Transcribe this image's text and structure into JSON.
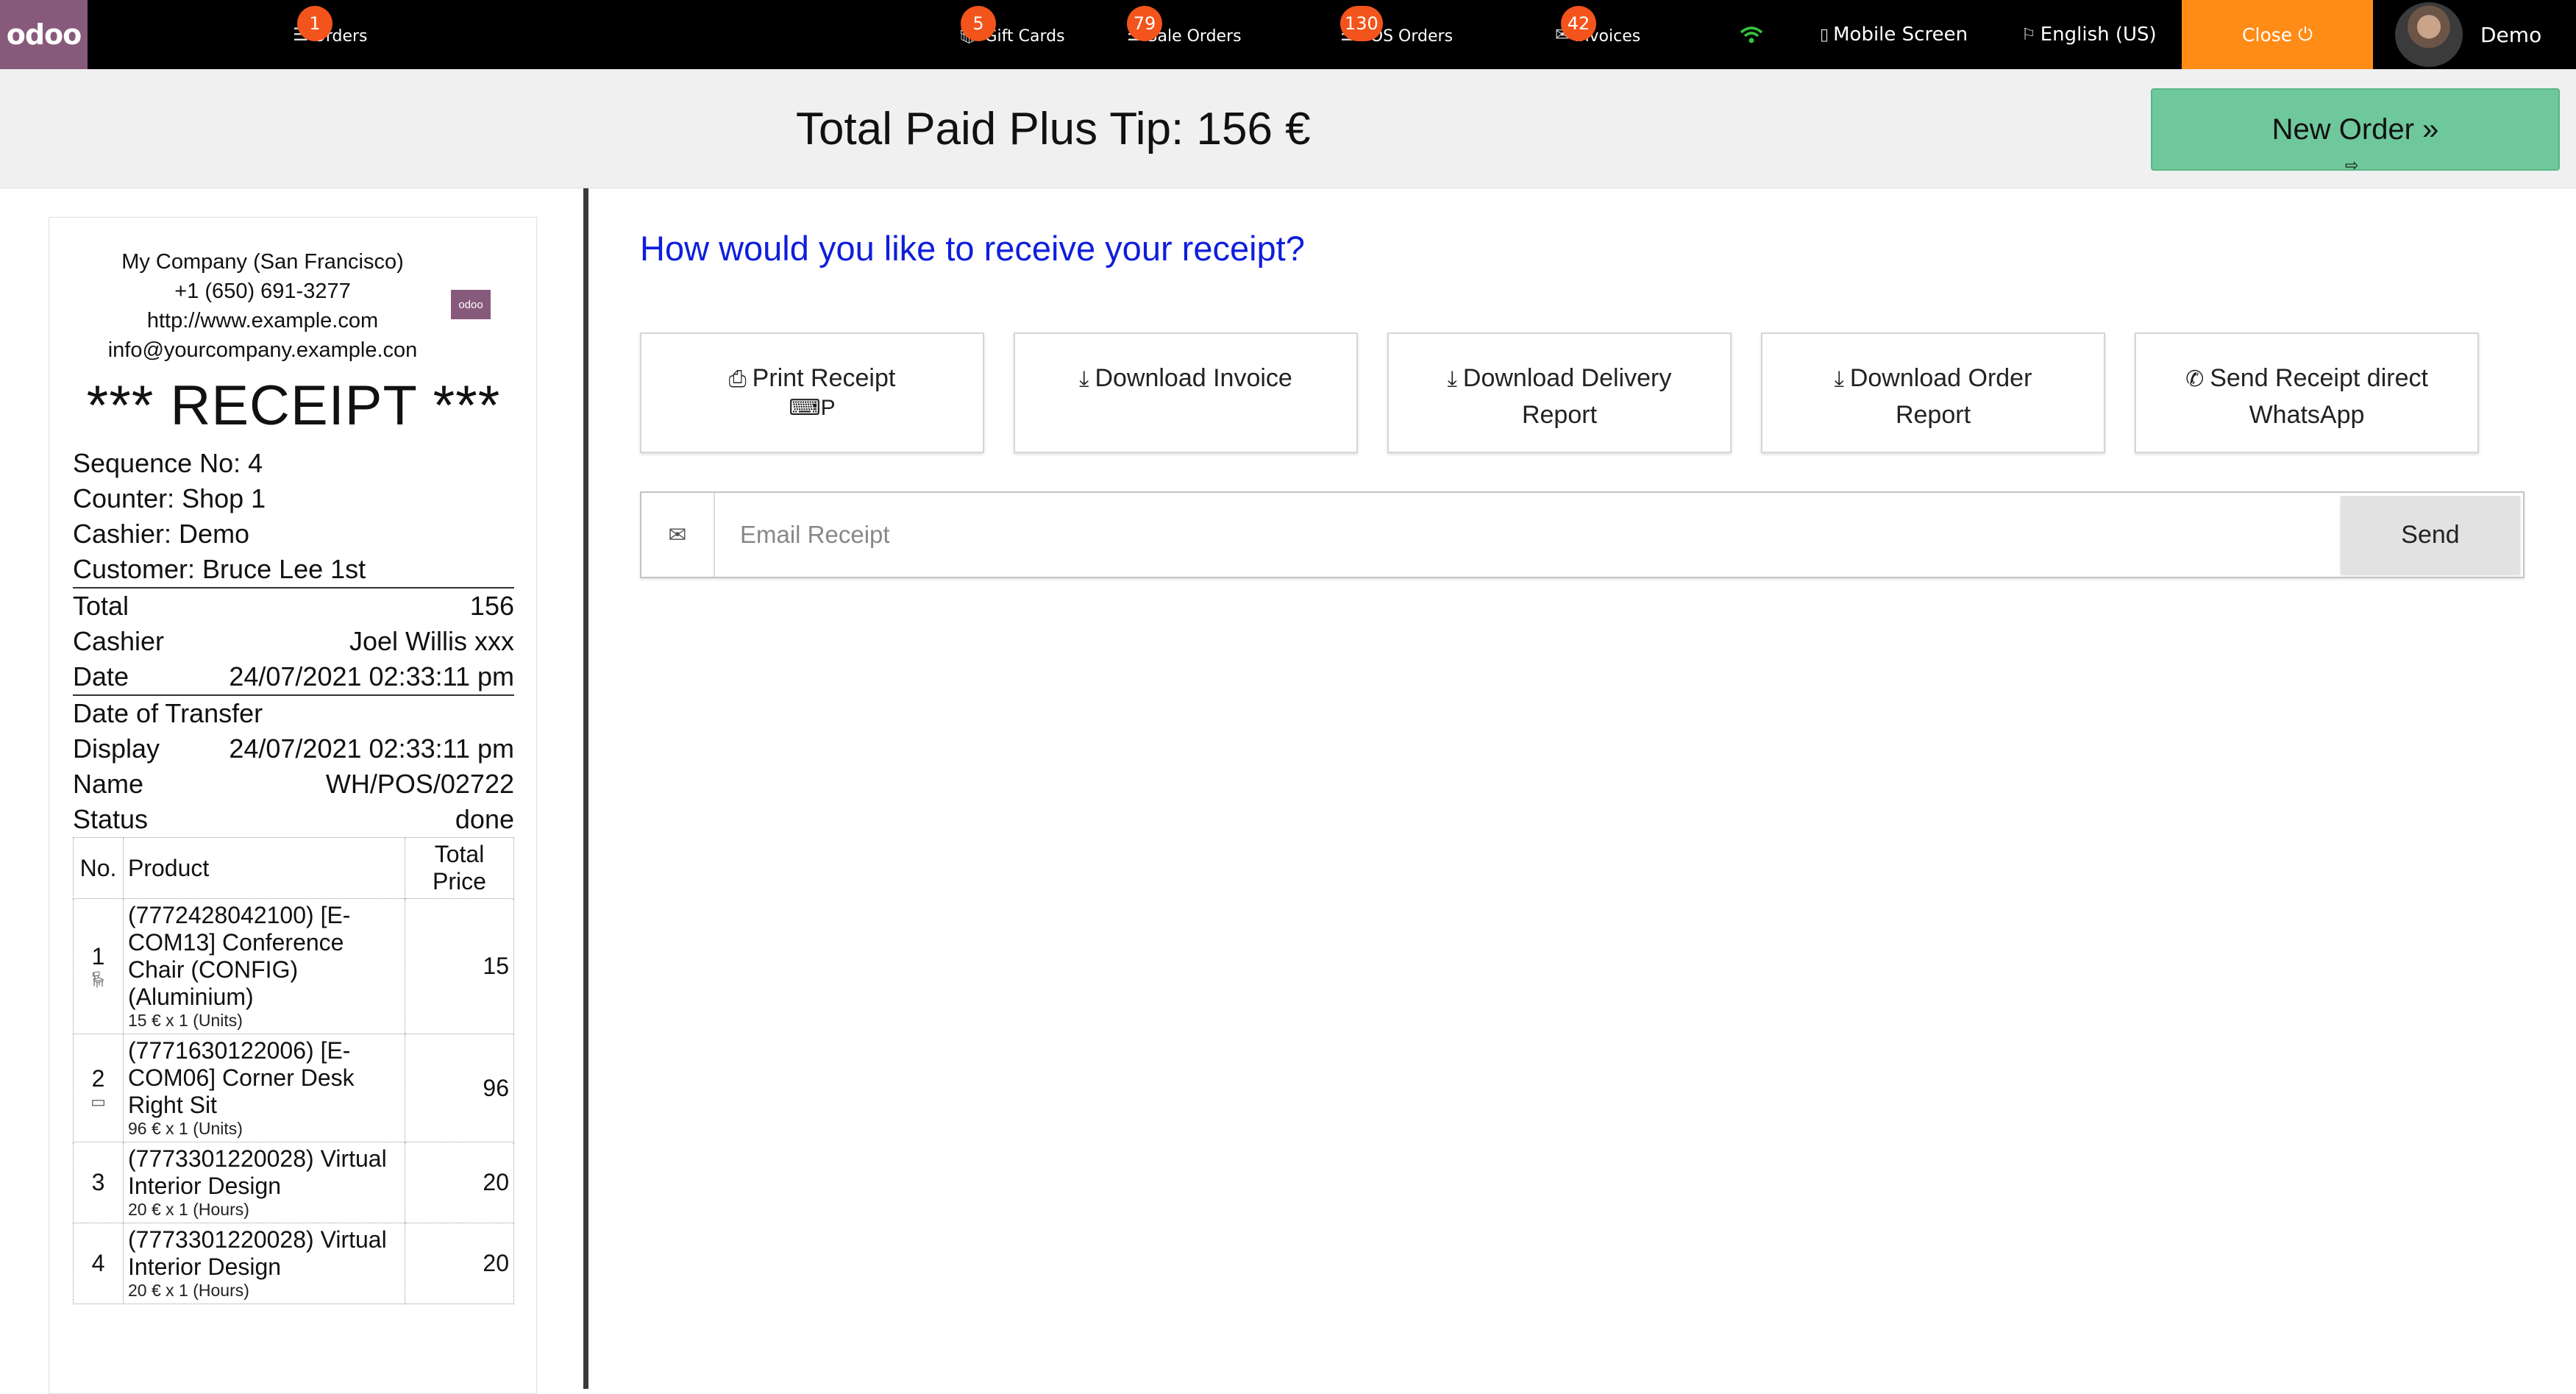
{
  "topbar": {
    "logo": "odoo",
    "nav": [
      {
        "label": "Orders",
        "badge": "1"
      },
      {
        "label": "Gift Cards",
        "badge": "5"
      },
      {
        "label": "Sale Orders",
        "badge": "79"
      },
      {
        "label": "POS Orders",
        "badge": "130"
      },
      {
        "label": "Invoices",
        "badge": "42"
      }
    ],
    "mobile_screen": "Mobile Screen",
    "language": "English (US)",
    "close_label": "Close",
    "username": "Demo",
    "colors": {
      "logo": "#875a7b",
      "badge": "#f3541b",
      "close": "#ff8c16",
      "wifi": "#36c23b"
    }
  },
  "header": {
    "total_text": "Total Paid Plus Tip: 156 €",
    "new_order_label": "New Order »"
  },
  "receipt": {
    "company": {
      "name": "My Company (San Francisco)",
      "phone": "+1 (650) 691-3277",
      "website": "http://www.example.com",
      "email": "info@yourcompany.example.con"
    },
    "logo_text": "odoo",
    "title": "*** RECEIPT ***",
    "sequence": "Sequence No: 4",
    "counter": "Counter: Shop 1",
    "cashier_line": "Cashier: Demo",
    "customer": "Customer: Bruce Lee 1st",
    "details": [
      {
        "label": "Total",
        "value": "156"
      },
      {
        "label": "Cashier",
        "value": "Joel Willis xxx"
      },
      {
        "label": "Date",
        "value": "24/07/2021 02:33:11 pm"
      }
    ],
    "transfer_label": "Date of Transfer",
    "details2": [
      {
        "label": "Display",
        "value": "24/07/2021 02:33:11 pm"
      },
      {
        "label": "Name",
        "value": "WH/POS/02722"
      },
      {
        "label": "Status",
        "value": "done"
      }
    ],
    "table_headers": {
      "no": "No.",
      "product": "Product",
      "total": "Total Price"
    },
    "lines": [
      {
        "no": "1",
        "product": "(7772428042100) [E-COM13] Conference Chair (CONFIG) (Aluminium)",
        "unit": "15 € x 1 (Units)",
        "total": "15"
      },
      {
        "no": "2",
        "product": "(7771630122006) [E-COM06] Corner Desk Right Sit",
        "unit": "96 € x 1 (Units)",
        "total": "96"
      },
      {
        "no": "3",
        "product": "(7773301220028) Virtual Interior Design",
        "unit": "20 € x 1 (Hours)",
        "total": "20"
      },
      {
        "no": "4",
        "product": "(7773301220028) Virtual Interior Design",
        "unit": "20 € x 1 (Hours)",
        "total": "20"
      }
    ]
  },
  "main": {
    "question": "How would you like to receive your receipt?",
    "options": [
      {
        "icon": "print-icon",
        "label": "Print Receipt",
        "sub": "⌨P"
      },
      {
        "icon": "download-icon",
        "label": "Download Invoice",
        "sub": ""
      },
      {
        "icon": "download-icon",
        "label": "Download Delivery Report",
        "sub": ""
      },
      {
        "icon": "download-icon",
        "label": "Download Order Report",
        "sub": ""
      },
      {
        "icon": "whatsapp-icon",
        "label": "Send Receipt direct WhatsApp",
        "sub": ""
      }
    ],
    "email_placeholder": "Email Receipt",
    "send_label": "Send",
    "question_color": "#0e1edc",
    "new_order_color": "#6ec89b"
  }
}
